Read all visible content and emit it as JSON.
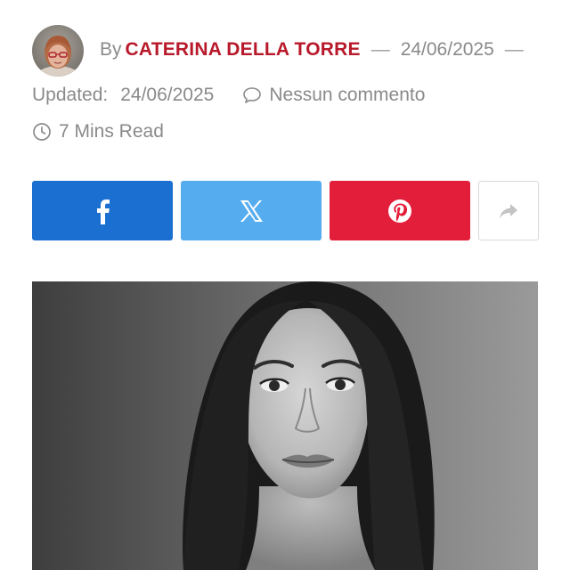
{
  "byline": {
    "prefix": "By",
    "author": "CATERINA DELLA TORRE",
    "dash_before_date": "—",
    "date": "24/06/2025",
    "dash_after_date": "—"
  },
  "meta": {
    "updated_label": "Updated:",
    "updated_date": "24/06/2025",
    "comments": "Nessun commento",
    "comment_icon": "speech-bubble-icon",
    "read_time": "7 Mins Read",
    "read_time_icon": "clock-icon"
  },
  "share": {
    "buttons": [
      {
        "network": "facebook",
        "icon": "facebook-icon",
        "color": "#1b6fd1"
      },
      {
        "network": "x",
        "icon": "x-icon",
        "color": "#55acee"
      },
      {
        "network": "pinterest",
        "icon": "pinterest-icon",
        "color": "#e31e3a"
      },
      {
        "network": "more",
        "icon": "share-arrow-icon",
        "color": "#ffffff"
      }
    ]
  },
  "colors": {
    "author_accent": "#b8192a",
    "meta_text": "#8a8a8a"
  }
}
